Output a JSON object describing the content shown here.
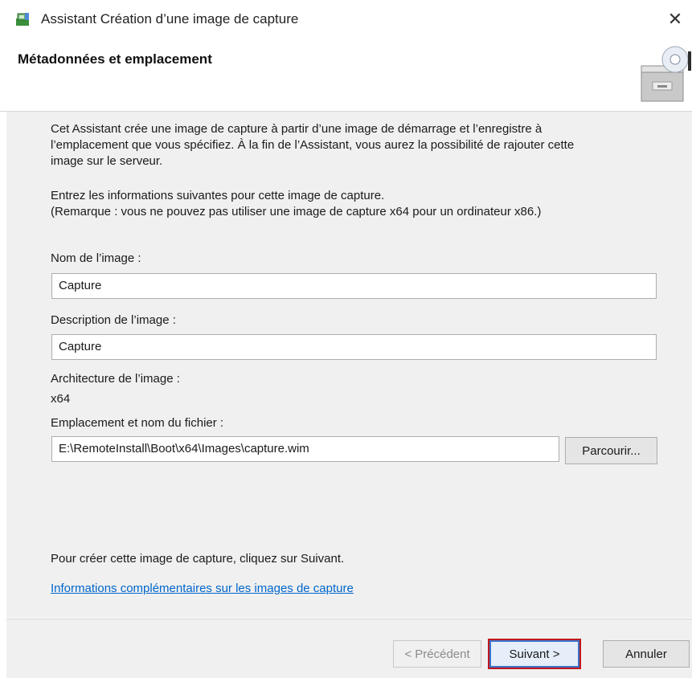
{
  "window": {
    "title": "Assistant Création d’une image de capture",
    "close_glyph": "✕"
  },
  "header": {
    "title": "Métadonnées et emplacement",
    "art_icon": "drive-cabinet-icon"
  },
  "content": {
    "intro_lines": [
      "Cet Assistant crée une image de capture à partir d’une image de démarrage et l’enregistre à",
      "l’emplacement que vous spécifiez. À la fin de l’Assistant, vous aurez la possibilité de rajouter cette",
      "image sur le serveur."
    ],
    "instructions_lines": [
      "Entrez les informations suivantes pour cette image de capture.",
      "(Remarque : vous ne pouvez pas utiliser une image de capture x64 pour un ordinateur x86.)"
    ],
    "image_name": {
      "label": "Nom de l’image :",
      "value": "Capture"
    },
    "image_description": {
      "label": "Description de l’image :",
      "value": "Capture"
    },
    "architecture": {
      "label": "Architecture de l’image :",
      "value": "x64"
    },
    "file_location": {
      "label": "Emplacement et nom du fichier :",
      "value": "E:\\RemoteInstall\\Boot\\x64\\Images\\capture.wim",
      "browse_label": "Parcourir..."
    },
    "next_hint": "Pour créer cette image de capture, cliquez sur Suivant.",
    "more_info_link": "Informations complémentaires sur les images de capture"
  },
  "footer": {
    "previous_label": "< Précédent",
    "next_label": "Suivant >",
    "cancel_label": "Annuler"
  },
  "colors": {
    "content_bg": "#f0f0f0",
    "link": "#0066cc",
    "highlight": "#c0161c"
  }
}
